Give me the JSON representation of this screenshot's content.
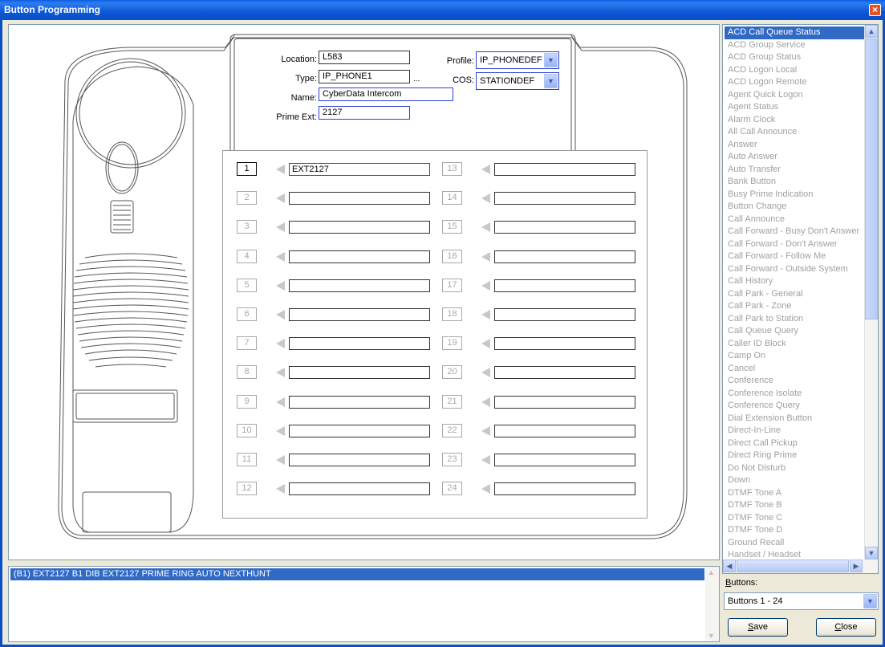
{
  "window": {
    "title": "Button Programming"
  },
  "header": {
    "location_label": "Location:",
    "location_value": "L583",
    "type_label": "Type:",
    "type_value": "IP_PHONE1",
    "name_label": "Name:",
    "name_value": "CyberData Intercom",
    "prime_label": "Prime Ext:",
    "prime_value": "2127",
    "profile_label": "Profile:",
    "profile_value": "IP_PHONEDEF",
    "cos_label": "COS:",
    "cos_value": "STATIONDEF",
    "ellipsis": "..."
  },
  "buttons": [
    {
      "num": "1",
      "value": "EXT2127"
    },
    {
      "num": "2",
      "value": ""
    },
    {
      "num": "3",
      "value": ""
    },
    {
      "num": "4",
      "value": ""
    },
    {
      "num": "5",
      "value": ""
    },
    {
      "num": "6",
      "value": ""
    },
    {
      "num": "7",
      "value": ""
    },
    {
      "num": "8",
      "value": ""
    },
    {
      "num": "9",
      "value": ""
    },
    {
      "num": "10",
      "value": ""
    },
    {
      "num": "11",
      "value": ""
    },
    {
      "num": "12",
      "value": ""
    },
    {
      "num": "13",
      "value": ""
    },
    {
      "num": "14",
      "value": ""
    },
    {
      "num": "15",
      "value": ""
    },
    {
      "num": "16",
      "value": ""
    },
    {
      "num": "17",
      "value": ""
    },
    {
      "num": "18",
      "value": ""
    },
    {
      "num": "19",
      "value": ""
    },
    {
      "num": "20",
      "value": ""
    },
    {
      "num": "21",
      "value": ""
    },
    {
      "num": "22",
      "value": ""
    },
    {
      "num": "23",
      "value": ""
    },
    {
      "num": "24",
      "value": ""
    }
  ],
  "features": [
    "ACD Call Queue Status",
    "ACD Group Service",
    "ACD Group Status",
    "ACD Logon Local",
    "ACD Logon Remote",
    "Agent Quick Logon",
    "Agent Status",
    "Alarm Clock",
    "All Call Announce",
    "Answer",
    "Auto Answer",
    "Auto Transfer",
    "Bank Button",
    "Busy Prime Indication",
    "Button Change",
    "Call Announce",
    "Call Forward - Busy Don't Answer",
    "Call Forward - Don't Answer",
    "Call Forward - Follow Me",
    "Call Forward - Outside System",
    "Call History",
    "Call Park - General",
    "Call Park - Zone",
    "Call Park to Station",
    "Call Queue Query",
    "Caller ID Block",
    "Camp On",
    "Cancel",
    "Conference",
    "Conference Isolate",
    "Conference Query",
    "Dial Extension Button",
    "Direct-In-Line",
    "Direct Call Pickup",
    "Direct Ring Prime",
    "Do Not Disturb",
    "Down",
    "DTMF Tone A",
    "DTMF Tone B",
    "DTMF Tone C",
    "DTMF Tone D",
    "Ground Recall",
    "Handset / Headset"
  ],
  "status": {
    "line": "(B1) EXT2127 B1 DIB EXT2127 PRIME RING AUTO NEXTHUNT"
  },
  "controls": {
    "buttons_label": "Buttons:",
    "buttons_value": "Buttons 1 - 24",
    "save": "Save",
    "close": "Close"
  }
}
